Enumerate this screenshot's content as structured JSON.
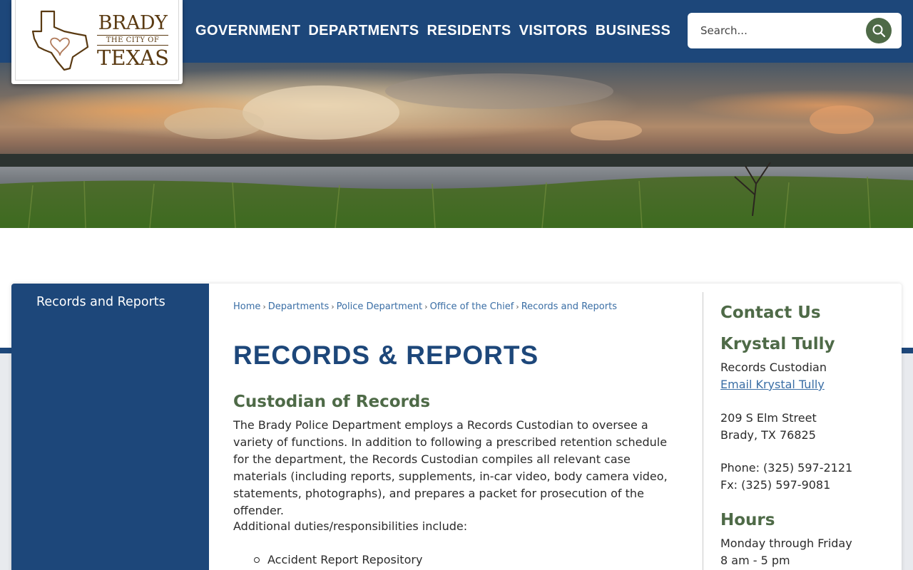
{
  "header": {
    "logo": {
      "line1": "BRADY",
      "line2": "THE CITY OF",
      "line3": "TEXAS"
    },
    "nav": [
      {
        "label": "GOVERNMENT"
      },
      {
        "label": "DEPARTMENTS"
      },
      {
        "label": "RESIDENTS"
      },
      {
        "label": "VISITORS"
      },
      {
        "label": "BUSINESS"
      }
    ],
    "search": {
      "placeholder": "Search..."
    }
  },
  "sidebar": {
    "items": [
      {
        "label": "Records and Reports"
      }
    ]
  },
  "breadcrumb": [
    {
      "label": "Home"
    },
    {
      "label": "Departments"
    },
    {
      "label": "Police Department"
    },
    {
      "label": "Office of the Chief"
    },
    {
      "label": "Records and Reports"
    }
  ],
  "main": {
    "title": "RECORDS & REPORTS",
    "section_heading": "Custodian of Records",
    "paragraph": "The Brady Police Department employs a Records Custodian to oversee a variety of functions. In addition to following a prescribed retention schedule for the department, the Records Custodian compiles all relevant case materials (including reports, supplements, in-car video, body camera video, statements, photographs), and prepares a packet for prosecution of the offender.",
    "paragraph2": "Additional duties/responsibilities include:",
    "list": [
      "Accident Report Repository"
    ]
  },
  "contact": {
    "title": "Contact Us",
    "name": "Krystal Tully",
    "role": "Records Custodian",
    "email_link": "Email Krystal Tully",
    "address_line1": "209 S Elm Street",
    "address_line2": "Brady, TX 76825",
    "phone": "Phone: (325) 597-2121",
    "fax": "Fx: (325) 597-9081",
    "hours_title": "Hours",
    "hours_days": "Monday through Friday",
    "hours_time": "8 am - 5 pm"
  },
  "colors": {
    "brand_blue": "#1d477a",
    "accent_green": "#4e6a47",
    "link_blue": "#3a6ea5"
  }
}
